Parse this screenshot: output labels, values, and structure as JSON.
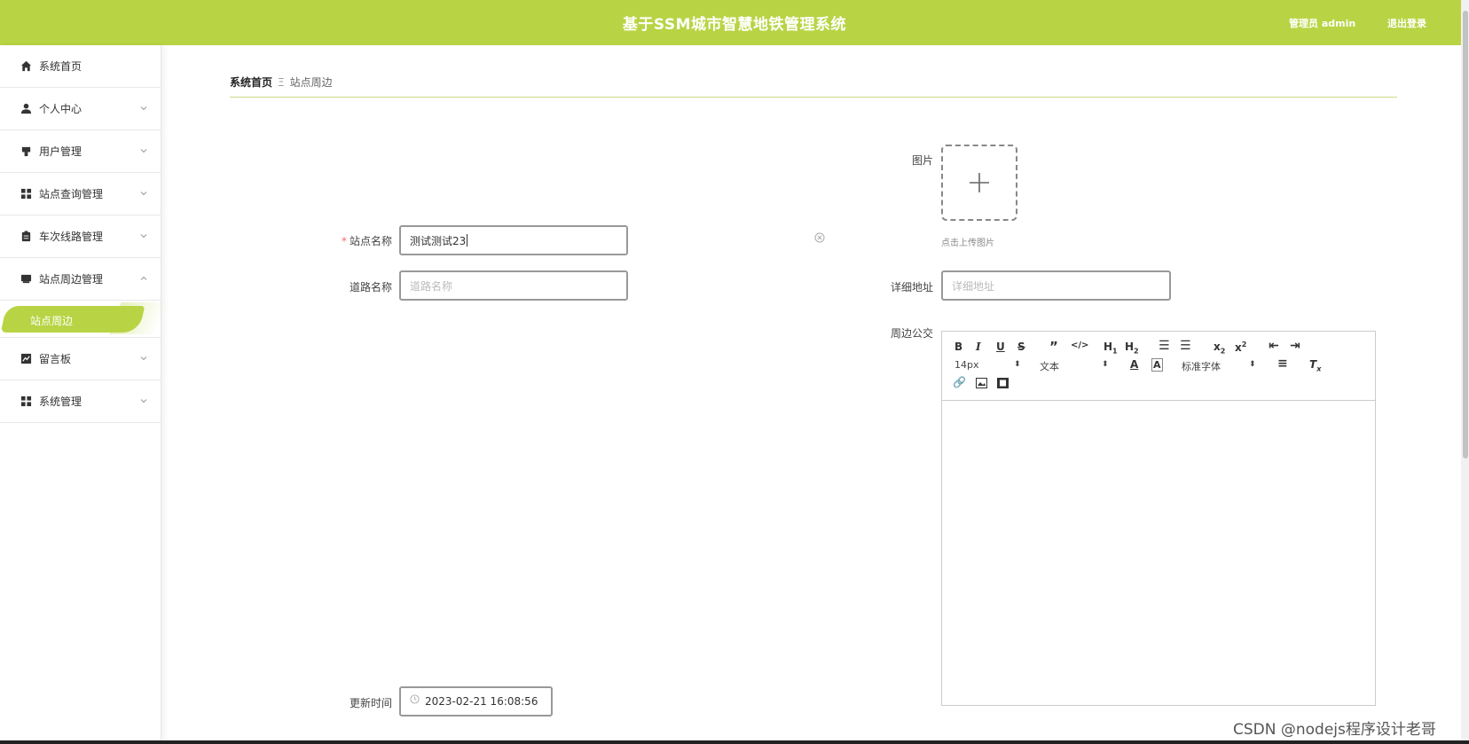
{
  "header": {
    "title": "基于SSM城市智慧地铁管理系统",
    "user_label": "管理员 admin",
    "logout_label": "退出登录"
  },
  "sidebar": {
    "items": [
      {
        "label": "系统首页",
        "icon": "home-icon"
      },
      {
        "label": "个人中心",
        "icon": "user-icon"
      },
      {
        "label": "用户管理",
        "icon": "users-icon"
      },
      {
        "label": "站点查询管理",
        "icon": "grid-icon"
      },
      {
        "label": "车次线路管理",
        "icon": "clipboard-icon"
      },
      {
        "label": "站点周边管理",
        "icon": "inbox-icon"
      },
      {
        "label": "留言板",
        "icon": "chart-icon"
      },
      {
        "label": "系统管理",
        "icon": "grid-icon"
      }
    ],
    "active_sub": "站点周边",
    "accent_color": "#b8d444"
  },
  "breadcrumb": {
    "home": "系统首页",
    "current": "站点周边"
  },
  "form": {
    "image_label": "图片",
    "upload_hint": "点击上传图片",
    "station_label": "站点名称",
    "station_value": "测试测试23",
    "road_label": "道路名称",
    "road_placeholder": "道路名称",
    "address_label": "详细地址",
    "address_placeholder": "详细地址",
    "transit_label": "周边公交",
    "update_label": "更新时间",
    "update_value": "2023-02-21 16:08:56"
  },
  "editor": {
    "font_size": "14px",
    "text_type": "文本",
    "font_family": "标准字体"
  },
  "watermark": "CSDN @nodejs程序设计老哥"
}
